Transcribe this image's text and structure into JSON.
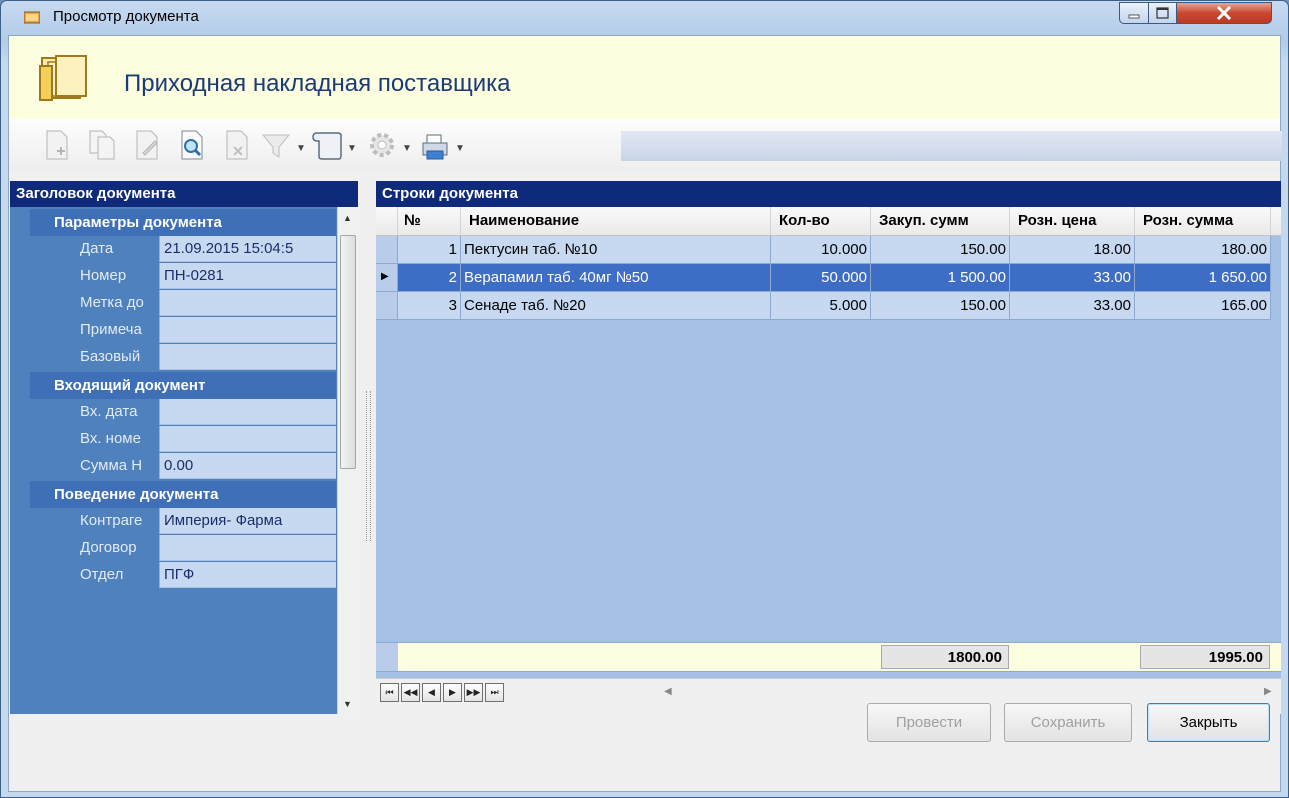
{
  "window": {
    "title": "Просмотр документа",
    "header_title": "Приходная накладная поставщика"
  },
  "left_panel": {
    "title": "Заголовок документа",
    "categories": [
      {
        "label": "Параметры документа",
        "props": [
          {
            "name": "Дата",
            "value": "21.09.2015 15:04:5"
          },
          {
            "name": "Номер",
            "value": "ПН-0281"
          },
          {
            "name": "Метка до",
            "value": ""
          },
          {
            "name": "Примеча",
            "value": ""
          },
          {
            "name": "Базовый",
            "value": ""
          }
        ]
      },
      {
        "label": "Входящий документ",
        "props": [
          {
            "name": "Вх. дата",
            "value": ""
          },
          {
            "name": "Вх. номе",
            "value": ""
          },
          {
            "name": "Сумма Н",
            "value": "0.00"
          }
        ]
      },
      {
        "label": "Поведение документа",
        "props": [
          {
            "name": "Контраге",
            "value": "Империя- Фарма"
          },
          {
            "name": "Договор",
            "value": ""
          },
          {
            "name": "Отдел",
            "value": "ПГФ"
          }
        ]
      }
    ]
  },
  "right_panel": {
    "title": "Строки документа",
    "columns": [
      "№",
      "Наименование",
      "Кол-во",
      "Закуп. сумм",
      "Розн. цена",
      "Розн. сумма"
    ],
    "rows": [
      {
        "n": "1",
        "name": "Пектусин таб. №10",
        "qty": "10.000",
        "buy_sum": "150.00",
        "retail_price": "18.00",
        "retail_sum": "180.00"
      },
      {
        "n": "2",
        "name": "Верапамил таб. 40мг №50",
        "qty": "50.000",
        "buy_sum": "1 500.00",
        "retail_price": "33.00",
        "retail_sum": "1 650.00"
      },
      {
        "n": "3",
        "name": "Сенаде таб. №20",
        "qty": "5.000",
        "buy_sum": "150.00",
        "retail_price": "33.00",
        "retail_sum": "165.00"
      }
    ],
    "totals": {
      "buy_sum": "1800.00",
      "retail_sum": "1995.00"
    }
  },
  "buttons": {
    "post": "Провести",
    "save": "Сохранить",
    "close": "Закрыть"
  }
}
